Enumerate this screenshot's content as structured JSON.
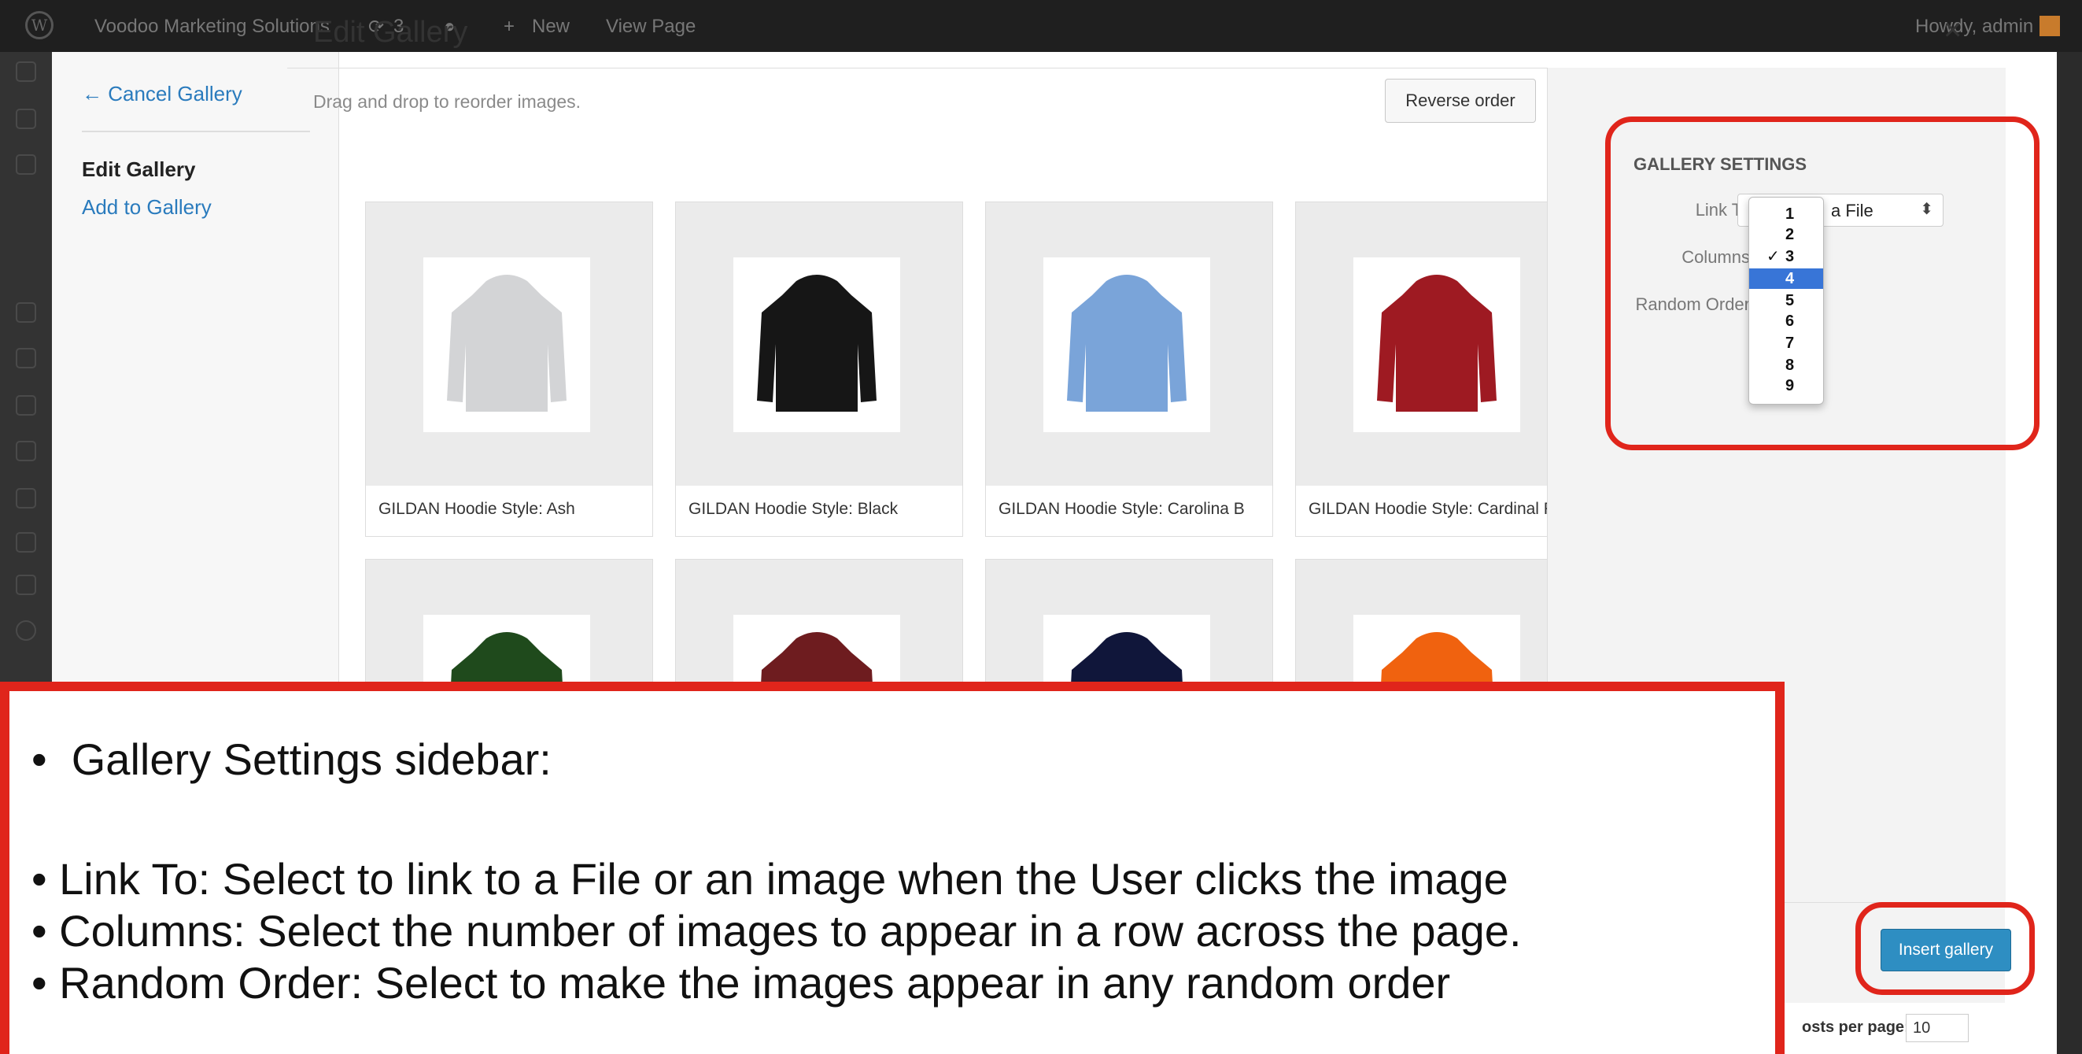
{
  "admin_bar": {
    "site_name": "Voodoo Marketing Solutions",
    "updates_count": "3",
    "new_label": "New",
    "view_page_label": "View Page",
    "greeting": "Howdy, admin"
  },
  "modal": {
    "cancel_link": "← Cancel Gallery",
    "menu": {
      "edit_gallery": "Edit Gallery",
      "add_to_gallery": "Add to Gallery"
    },
    "title": "Edit Gallery",
    "close_glyph": "×",
    "hint": "Drag and drop to reorder images.",
    "reverse_button": "Reverse order",
    "items": [
      {
        "caption": "GILDAN Hoodie Style: Ash",
        "color": "#d3d4d6"
      },
      {
        "caption": "GILDAN Hoodie Style: Black",
        "color": "#161616"
      },
      {
        "caption": "GILDAN Hoodie Style: Carolina B",
        "color": "#7aa4d9"
      },
      {
        "caption": "GILDAN Hoodie Style: Cardinal F",
        "color": "#9e1a22"
      },
      {
        "caption": "",
        "color": "#1f4a1c"
      },
      {
        "caption": "",
        "color": "#6e1c1f"
      },
      {
        "caption": "",
        "color": "#10163a"
      },
      {
        "caption": "",
        "color": "#f0620f"
      }
    ],
    "settings": {
      "title": "GALLERY SETTINGS",
      "link_to_label": "Link To",
      "link_to_value": "a File",
      "columns_label": "Columns",
      "random_order_label": "Random Order",
      "columns_options": [
        "1",
        "2",
        "3",
        "4",
        "5",
        "6",
        "7",
        "8",
        "9"
      ],
      "columns_checked": "3",
      "columns_highlighted": "4"
    },
    "insert_button": "Insert gallery"
  },
  "background": {
    "posts_per_page_label": "osts per page:",
    "posts_per_page_value": "10"
  },
  "annotation": {
    "heading": "Gallery Settings sidebar:",
    "lines": [
      "• Link To: Select to link to a File or an image when the User clicks the image",
      "• Columns: Select the number of images to appear in a row across the page.",
      "• Random Order: Select to make the images appear in any random order"
    ]
  },
  "colors": {
    "highlight": "#e0251b",
    "link": "#2a7bbd",
    "primary_button": "#2e8ec2",
    "option_selected": "#3875d7"
  }
}
